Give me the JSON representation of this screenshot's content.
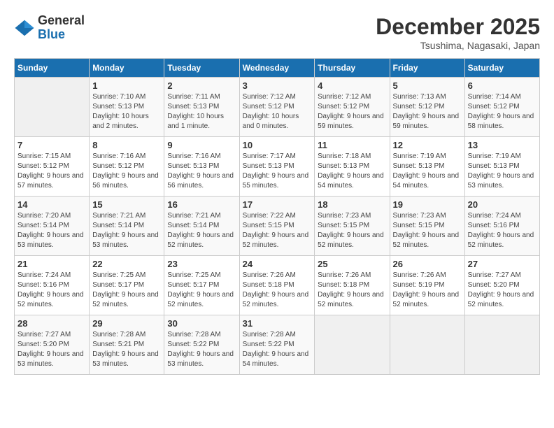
{
  "logo": {
    "general": "General",
    "blue": "Blue"
  },
  "header": {
    "month": "December 2025",
    "location": "Tsushima, Nagasaki, Japan"
  },
  "weekdays": [
    "Sunday",
    "Monday",
    "Tuesday",
    "Wednesday",
    "Thursday",
    "Friday",
    "Saturday"
  ],
  "weeks": [
    [
      {
        "day": "",
        "sunrise": "",
        "sunset": "",
        "daylight": ""
      },
      {
        "day": "1",
        "sunrise": "Sunrise: 7:10 AM",
        "sunset": "Sunset: 5:13 PM",
        "daylight": "Daylight: 10 hours and 2 minutes."
      },
      {
        "day": "2",
        "sunrise": "Sunrise: 7:11 AM",
        "sunset": "Sunset: 5:13 PM",
        "daylight": "Daylight: 10 hours and 1 minute."
      },
      {
        "day": "3",
        "sunrise": "Sunrise: 7:12 AM",
        "sunset": "Sunset: 5:12 PM",
        "daylight": "Daylight: 10 hours and 0 minutes."
      },
      {
        "day": "4",
        "sunrise": "Sunrise: 7:12 AM",
        "sunset": "Sunset: 5:12 PM",
        "daylight": "Daylight: 9 hours and 59 minutes."
      },
      {
        "day": "5",
        "sunrise": "Sunrise: 7:13 AM",
        "sunset": "Sunset: 5:12 PM",
        "daylight": "Daylight: 9 hours and 59 minutes."
      },
      {
        "day": "6",
        "sunrise": "Sunrise: 7:14 AM",
        "sunset": "Sunset: 5:12 PM",
        "daylight": "Daylight: 9 hours and 58 minutes."
      }
    ],
    [
      {
        "day": "7",
        "sunrise": "Sunrise: 7:15 AM",
        "sunset": "Sunset: 5:12 PM",
        "daylight": "Daylight: 9 hours and 57 minutes."
      },
      {
        "day": "8",
        "sunrise": "Sunrise: 7:16 AM",
        "sunset": "Sunset: 5:12 PM",
        "daylight": "Daylight: 9 hours and 56 minutes."
      },
      {
        "day": "9",
        "sunrise": "Sunrise: 7:16 AM",
        "sunset": "Sunset: 5:13 PM",
        "daylight": "Daylight: 9 hours and 56 minutes."
      },
      {
        "day": "10",
        "sunrise": "Sunrise: 7:17 AM",
        "sunset": "Sunset: 5:13 PM",
        "daylight": "Daylight: 9 hours and 55 minutes."
      },
      {
        "day": "11",
        "sunrise": "Sunrise: 7:18 AM",
        "sunset": "Sunset: 5:13 PM",
        "daylight": "Daylight: 9 hours and 54 minutes."
      },
      {
        "day": "12",
        "sunrise": "Sunrise: 7:19 AM",
        "sunset": "Sunset: 5:13 PM",
        "daylight": "Daylight: 9 hours and 54 minutes."
      },
      {
        "day": "13",
        "sunrise": "Sunrise: 7:19 AM",
        "sunset": "Sunset: 5:13 PM",
        "daylight": "Daylight: 9 hours and 53 minutes."
      }
    ],
    [
      {
        "day": "14",
        "sunrise": "Sunrise: 7:20 AM",
        "sunset": "Sunset: 5:14 PM",
        "daylight": "Daylight: 9 hours and 53 minutes."
      },
      {
        "day": "15",
        "sunrise": "Sunrise: 7:21 AM",
        "sunset": "Sunset: 5:14 PM",
        "daylight": "Daylight: 9 hours and 53 minutes."
      },
      {
        "day": "16",
        "sunrise": "Sunrise: 7:21 AM",
        "sunset": "Sunset: 5:14 PM",
        "daylight": "Daylight: 9 hours and 52 minutes."
      },
      {
        "day": "17",
        "sunrise": "Sunrise: 7:22 AM",
        "sunset": "Sunset: 5:15 PM",
        "daylight": "Daylight: 9 hours and 52 minutes."
      },
      {
        "day": "18",
        "sunrise": "Sunrise: 7:23 AM",
        "sunset": "Sunset: 5:15 PM",
        "daylight": "Daylight: 9 hours and 52 minutes."
      },
      {
        "day": "19",
        "sunrise": "Sunrise: 7:23 AM",
        "sunset": "Sunset: 5:15 PM",
        "daylight": "Daylight: 9 hours and 52 minutes."
      },
      {
        "day": "20",
        "sunrise": "Sunrise: 7:24 AM",
        "sunset": "Sunset: 5:16 PM",
        "daylight": "Daylight: 9 hours and 52 minutes."
      }
    ],
    [
      {
        "day": "21",
        "sunrise": "Sunrise: 7:24 AM",
        "sunset": "Sunset: 5:16 PM",
        "daylight": "Daylight: 9 hours and 52 minutes."
      },
      {
        "day": "22",
        "sunrise": "Sunrise: 7:25 AM",
        "sunset": "Sunset: 5:17 PM",
        "daylight": "Daylight: 9 hours and 52 minutes."
      },
      {
        "day": "23",
        "sunrise": "Sunrise: 7:25 AM",
        "sunset": "Sunset: 5:17 PM",
        "daylight": "Daylight: 9 hours and 52 minutes."
      },
      {
        "day": "24",
        "sunrise": "Sunrise: 7:26 AM",
        "sunset": "Sunset: 5:18 PM",
        "daylight": "Daylight: 9 hours and 52 minutes."
      },
      {
        "day": "25",
        "sunrise": "Sunrise: 7:26 AM",
        "sunset": "Sunset: 5:18 PM",
        "daylight": "Daylight: 9 hours and 52 minutes."
      },
      {
        "day": "26",
        "sunrise": "Sunrise: 7:26 AM",
        "sunset": "Sunset: 5:19 PM",
        "daylight": "Daylight: 9 hours and 52 minutes."
      },
      {
        "day": "27",
        "sunrise": "Sunrise: 7:27 AM",
        "sunset": "Sunset: 5:20 PM",
        "daylight": "Daylight: 9 hours and 52 minutes."
      }
    ],
    [
      {
        "day": "28",
        "sunrise": "Sunrise: 7:27 AM",
        "sunset": "Sunset: 5:20 PM",
        "daylight": "Daylight: 9 hours and 53 minutes."
      },
      {
        "day": "29",
        "sunrise": "Sunrise: 7:28 AM",
        "sunset": "Sunset: 5:21 PM",
        "daylight": "Daylight: 9 hours and 53 minutes."
      },
      {
        "day": "30",
        "sunrise": "Sunrise: 7:28 AM",
        "sunset": "Sunset: 5:22 PM",
        "daylight": "Daylight: 9 hours and 53 minutes."
      },
      {
        "day": "31",
        "sunrise": "Sunrise: 7:28 AM",
        "sunset": "Sunset: 5:22 PM",
        "daylight": "Daylight: 9 hours and 54 minutes."
      },
      {
        "day": "",
        "sunrise": "",
        "sunset": "",
        "daylight": ""
      },
      {
        "day": "",
        "sunrise": "",
        "sunset": "",
        "daylight": ""
      },
      {
        "day": "",
        "sunrise": "",
        "sunset": "",
        "daylight": ""
      }
    ]
  ]
}
